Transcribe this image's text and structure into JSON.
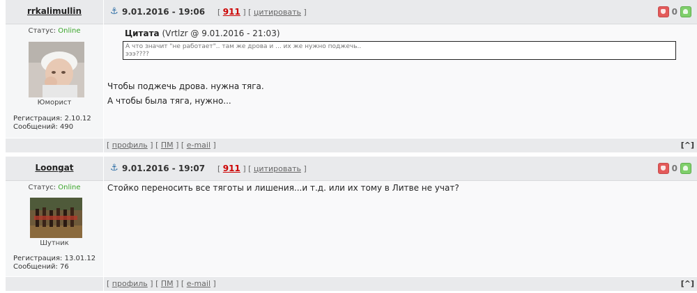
{
  "posts": [
    {
      "author": "rrkalimullin",
      "date": "9.01.2016 - 19:06",
      "post_number": "911",
      "cite_label": "цитировать",
      "status_label": "Статус:",
      "status_value": "Online",
      "rank": "Юморист",
      "registration": "Регистрация: 2.10.12",
      "messages": "Сообщений: 490",
      "rating": "0",
      "quote": {
        "title": "Цитата",
        "source": "(Vrtlzr @ 9.01.2016 - 21:03)",
        "line1": "А что значит \"не работает\".. там же дрова и ... их же нужно поджечь..",
        "line2": "эээ????"
      },
      "text_lines": [
        "Чтобы поджечь дрова. нужна тяга.",
        "А чтобы была тяга, нужно..."
      ],
      "footer": {
        "profile": "профиль",
        "pm": "ПМ",
        "email": "e-mail",
        "top": "[^]"
      }
    },
    {
      "author": "Loongat",
      "date": "9.01.2016 - 19:07",
      "post_number": "911",
      "cite_label": "цитировать",
      "status_label": "Статус:",
      "status_value": "Online",
      "rank": "Шутник",
      "registration": "Регистрация: 13.01.12",
      "messages": "Сообщений: 76",
      "rating": "0",
      "text_lines": [
        "Стойко переносить все тяготы и лишения...и т.д. или их тому в Литве не учат?"
      ],
      "footer": {
        "profile": "профиль",
        "pm": "ПМ",
        "email": "e-mail",
        "top": "[^]"
      }
    }
  ],
  "colors": {
    "header_bg": "#e9eaec",
    "online": "#3aa52a",
    "post_number": "#cc0000"
  },
  "icons": {
    "anchor": "anchor-icon",
    "down": "thumb-down-icon",
    "up": "thumb-up-icon"
  }
}
